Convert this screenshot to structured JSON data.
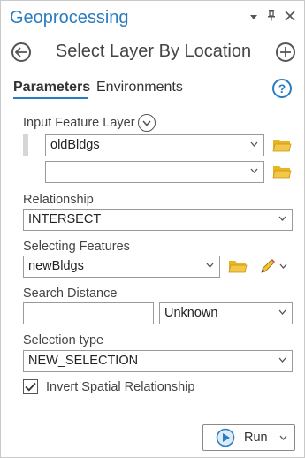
{
  "pane": {
    "title": "Geoprocessing",
    "controls": [
      "chevron-down-icon",
      "pin-icon",
      "close-icon"
    ]
  },
  "tool": {
    "title": "Select Layer By Location"
  },
  "tabs": [
    {
      "label": "Parameters",
      "active": true
    },
    {
      "label": "Environments",
      "active": false
    }
  ],
  "help_label": "?",
  "params": {
    "input_feature_layer": {
      "label": "Input Feature Layer",
      "values": [
        "oldBldgs",
        ""
      ]
    },
    "relationship": {
      "label": "Relationship",
      "value": "INTERSECT"
    },
    "selecting_features": {
      "label": "Selecting Features",
      "value": "newBldgs"
    },
    "search_distance": {
      "label": "Search Distance",
      "value": "",
      "unit": "Unknown"
    },
    "selection_type": {
      "label": "Selection type",
      "value": "NEW_SELECTION"
    },
    "invert": {
      "label": "Invert Spatial Relationship",
      "checked": true
    }
  },
  "run_button": {
    "label": "Run"
  },
  "colors": {
    "accent": "#2a7cc1",
    "folder": "#e8b523",
    "run_icon": "#2a7cc1"
  }
}
